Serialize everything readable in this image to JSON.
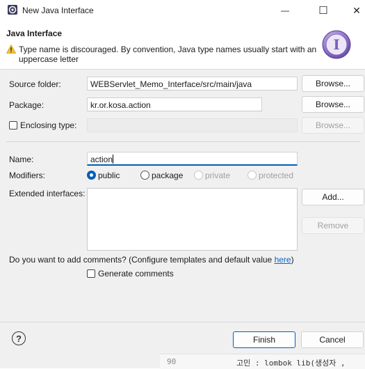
{
  "window": {
    "title": "New Java Interface",
    "minimize_glyph": "—",
    "maximize_glyph": "☐",
    "close_glyph": "✕"
  },
  "header": {
    "title": "Java Interface",
    "warning": "Type name is discouraged. By convention, Java type names usually start with an uppercase letter",
    "big_icon_letter": "I"
  },
  "form": {
    "source_folder": {
      "label": "Source folder:",
      "value": "WEBServlet_Memo_Interface/src/main/java",
      "button": "Browse..."
    },
    "package": {
      "label": "Package:",
      "value": "kr.or.kosa.action",
      "button": "Browse..."
    },
    "enclosing": {
      "label": "Enclosing type:",
      "value": "",
      "button": "Browse...",
      "checked": false
    },
    "name": {
      "label": "Name:",
      "value": "action"
    },
    "modifiers": {
      "label": "Modifiers:",
      "options": [
        "public",
        "package",
        "private",
        "protected"
      ],
      "selected": "public"
    },
    "extended": {
      "label": "Extended interfaces:",
      "add_button": "Add...",
      "remove_button": "Remove"
    },
    "comments": {
      "question": "Do you want to add comments? (Configure templates and default value ",
      "link": "here",
      "close_paren": ")",
      "generate_label": "Generate comments",
      "generate_checked": false
    }
  },
  "footer": {
    "help_glyph": "?",
    "finish": "Finish",
    "cancel": "Cancel"
  },
  "background_editor": {
    "line_number": "90",
    "code": "고민 : lombok lib(생성자 ,"
  },
  "colors": {
    "accent": "#005fb8",
    "link": "#0066cc",
    "warning": "#f2c230",
    "interface_icon": "#8a6fbf"
  }
}
